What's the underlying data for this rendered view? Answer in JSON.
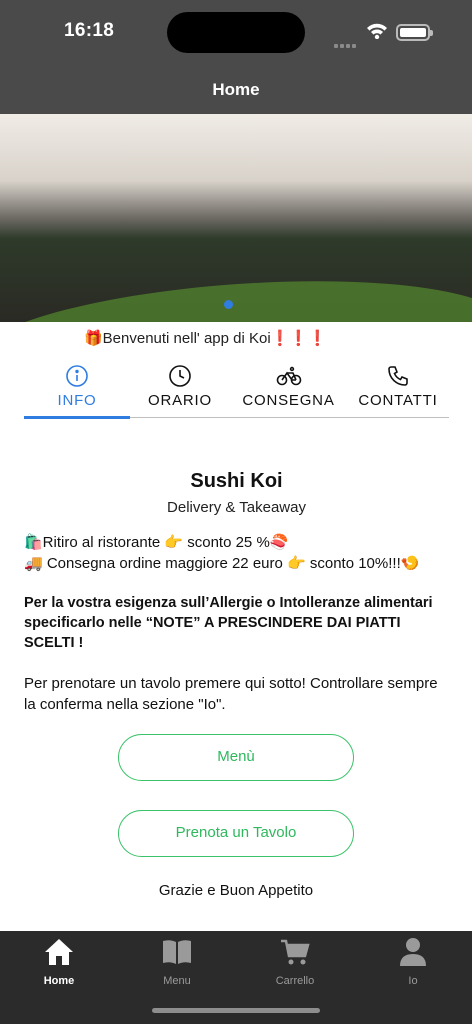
{
  "status_bar": {
    "time": "16:18"
  },
  "nav": {
    "title": "Home"
  },
  "welcome": {
    "text": "🎁Benvenuti nell' app di Koi❗❗❗"
  },
  "tabs": [
    {
      "label": "INFO",
      "icon": "info-icon",
      "active": true
    },
    {
      "label": "ORARIO",
      "icon": "clock-icon",
      "active": false
    },
    {
      "label": "CONSEGNA",
      "icon": "bicycle-icon",
      "active": false
    },
    {
      "label": "CONTATTI",
      "icon": "phone-icon",
      "active": false
    }
  ],
  "info": {
    "name": "Sushi Koi",
    "subtitle": "Delivery & Takeaway",
    "promo_lines": [
      "🛍️Ritiro al ristorante 👉 sconto 25 %🍣",
      "🚚 Consegna ordine maggiore 22 euro 👉 sconto 10%!!!🍤"
    ],
    "allergy_note": "Per la vostra esigenza sull’Allergie o Intolleranze alimentari specificarlo nelle “NOTE” A PRESCINDERE DAI PIATTI SCELTI !",
    "booking_note": "Per prenotare un tavolo premere qui sotto! Controllare sempre la conferma nella sezione \"Io\"."
  },
  "buttons": {
    "menu": "Menù",
    "book": "Prenota un Tavolo"
  },
  "thanks": "Grazie e Buon Appetito",
  "bottom_nav": [
    {
      "label": "Home",
      "icon": "home-icon",
      "active": true
    },
    {
      "label": "Menu",
      "icon": "book-icon",
      "active": false
    },
    {
      "label": "Carrello",
      "icon": "cart-icon",
      "active": false
    },
    {
      "label": "Io",
      "icon": "person-icon",
      "active": false
    }
  ],
  "colors": {
    "accent": "#2f7de1",
    "button_green": "#3bc36a",
    "bar_dark": "#4a4a4a",
    "tab_bar": "#2b2b2b"
  }
}
